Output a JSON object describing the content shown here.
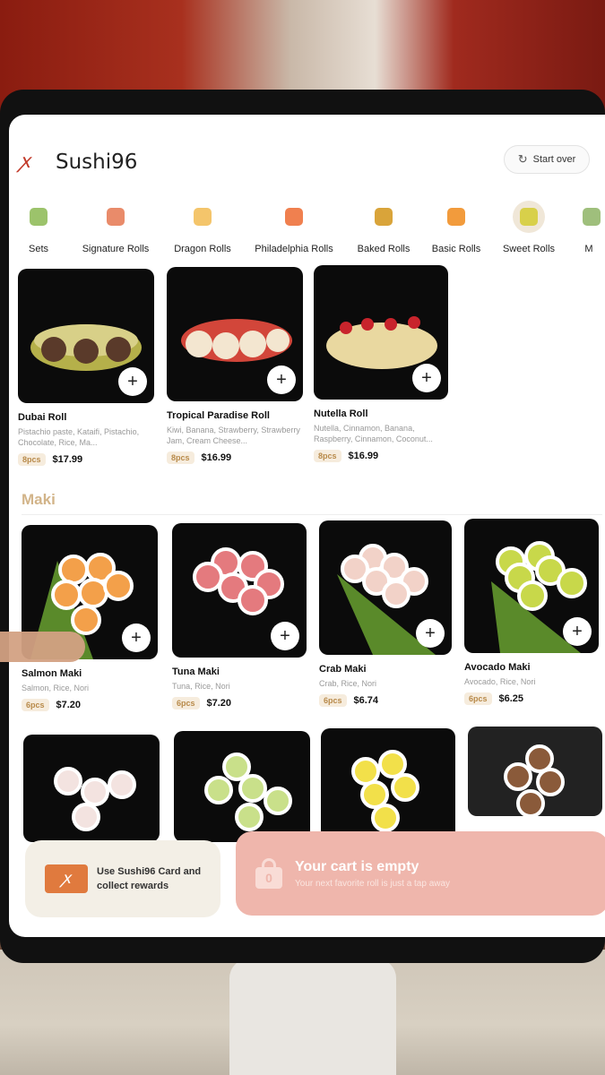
{
  "header": {
    "brand": "Sushi96",
    "start_over": "Start over"
  },
  "categories": [
    {
      "label": "Sets",
      "color": "#9cc36b"
    },
    {
      "label": "Signature Rolls",
      "color": "#e98b6a"
    },
    {
      "label": "Dragon Rolls",
      "color": "#f4c56b"
    },
    {
      "label": "Philadelphia Rolls",
      "color": "#f0804f"
    },
    {
      "label": "Baked Rolls",
      "color": "#d9a43a"
    },
    {
      "label": "Basic Rolls",
      "color": "#f29b3c"
    },
    {
      "label": "Sweet Rolls",
      "color": "#d8d04a"
    },
    {
      "label": "M",
      "color": "#9fbf7c"
    }
  ],
  "sweet_rolls": [
    {
      "name": "Dubai Roll",
      "desc": "Pistachio paste, Kataifi, Pistachio, Chocolate, Rice, Ma...",
      "pcs": "8pcs",
      "price": "$17.99",
      "color": "#b5b04a"
    },
    {
      "name": "Tropical Paradise Roll",
      "desc": "Kiwi, Banana, Strawberry, Strawberry Jam, Cream Cheese...",
      "pcs": "8pcs",
      "price": "$16.99",
      "color": "#d2463a"
    },
    {
      "name": "Nutella Roll",
      "desc": "Nutella, Cinnamon, Banana, Raspberry, Cinnamon, Coconut...",
      "pcs": "8pcs",
      "price": "$16.99",
      "color": "#e9d8a0"
    }
  ],
  "maki_section": {
    "title": "Maki"
  },
  "maki": [
    {
      "name": "Salmon Maki",
      "desc": "Salmon, Rice, Nori",
      "pcs": "6pcs",
      "price": "$7.20",
      "color": "#f3a04a"
    },
    {
      "name": "Tuna Maki",
      "desc": "Tuna, Rice, Nori",
      "pcs": "6pcs",
      "price": "$7.20",
      "color": "#e47a7e"
    },
    {
      "name": "Crab Maki",
      "desc": "Crab, Rice, Nori",
      "pcs": "6pcs",
      "price": "$6.74",
      "color": "#f2d2c8"
    },
    {
      "name": "Avocado Maki",
      "desc": "Avocado, Rice, Nori",
      "pcs": "6pcs",
      "price": "$6.25",
      "color": "#c8d84a"
    }
  ],
  "more_rolls_colors": [
    "#f3e3e0",
    "#c9e08a",
    "#f2e04a",
    "#8a5a3a"
  ],
  "add_label": "+",
  "footer": {
    "rewards_text": "Use Sushi96 Card and collect rewards",
    "cart_title": "Your cart is empty",
    "cart_sub": "Your next favorite roll is just a tap away",
    "cart_count": "0"
  }
}
